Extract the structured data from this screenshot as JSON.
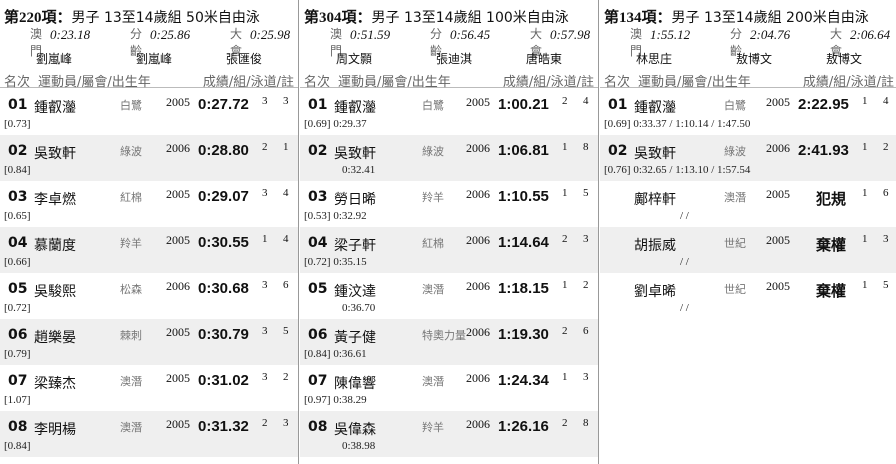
{
  "header": {
    "rank": "名次",
    "athlete": "運動員/屬會/出生年",
    "result": "成績/組/泳道/註"
  },
  "record_labels": {
    "macau": "澳門",
    "age": "分齡",
    "meet": "大會"
  },
  "events": [
    {
      "number": "第220項：",
      "description": "男子 13至14歲組 50米自由泳",
      "records": {
        "macau_time": "0:23.18",
        "macau_holder": "劉嵐峰",
        "age_time": "0:25.86",
        "age_holder": "劉嵐峰",
        "meet_time": "0:25.98",
        "meet_holder": "張匯俊"
      },
      "results": [
        {
          "rank": "01",
          "name": "鍾叡灐",
          "club": "白鷺",
          "year": "2005",
          "time": "0:27.72",
          "heat": "3",
          "lane": "3",
          "splits": "[0.73]"
        },
        {
          "rank": "02",
          "name": "吳致軒",
          "club": "綠波",
          "year": "2006",
          "time": "0:28.80",
          "heat": "2",
          "lane": "1",
          "splits": "[0.84]"
        },
        {
          "rank": "03",
          "name": "李卓燃",
          "club": "紅棉",
          "year": "2005",
          "time": "0:29.07",
          "heat": "3",
          "lane": "4",
          "splits": "[0.65]"
        },
        {
          "rank": "04",
          "name": "慕蘭度",
          "club": "羚羊",
          "year": "2005",
          "time": "0:30.55",
          "heat": "1",
          "lane": "4",
          "splits": "[0.66]"
        },
        {
          "rank": "05",
          "name": "吳駿熙",
          "club": "松森",
          "year": "2006",
          "time": "0:30.68",
          "heat": "3",
          "lane": "6",
          "splits": "[0.72]"
        },
        {
          "rank": "06",
          "name": "趙樂晏",
          "club": "棘刺",
          "year": "2005",
          "time": "0:30.79",
          "heat": "3",
          "lane": "5",
          "splits": "[0.79]"
        },
        {
          "rank": "07",
          "name": "梁臻杰",
          "club": "澳潛",
          "year": "2005",
          "time": "0:31.02",
          "heat": "3",
          "lane": "2",
          "splits": "[1.07]"
        },
        {
          "rank": "08",
          "name": "李明楊",
          "club": "澳潛",
          "year": "2005",
          "time": "0:31.32",
          "heat": "2",
          "lane": "3",
          "splits": "[0.84]"
        }
      ]
    },
    {
      "number": "第304項：",
      "description": "男子 13至14歲組 100米自由泳",
      "records": {
        "macau_time": "0:51.59",
        "macau_holder": "周文顥",
        "age_time": "0:56.45",
        "age_holder": "張迪淇",
        "meet_time": "0:57.98",
        "meet_holder": "唐皓東"
      },
      "results": [
        {
          "rank": "01",
          "name": "鍾叡灐",
          "club": "白鷺",
          "year": "2005",
          "time": "1:00.21",
          "heat": "2",
          "lane": "4",
          "splits": "[0.69]  0:29.37"
        },
        {
          "rank": "02",
          "name": "吳致軒",
          "club": "綠波",
          "year": "2006",
          "time": "1:06.81",
          "heat": "1",
          "lane": "8",
          "splits": "0:32.41"
        },
        {
          "rank": "03",
          "name": "勞日晞",
          "club": "羚羊",
          "year": "2006",
          "time": "1:10.55",
          "heat": "1",
          "lane": "5",
          "splits": "[0.53]  0:32.92"
        },
        {
          "rank": "04",
          "name": "梁子軒",
          "club": "紅棉",
          "year": "2006",
          "time": "1:14.64",
          "heat": "2",
          "lane": "3",
          "splits": "[0.72]  0:35.15"
        },
        {
          "rank": "05",
          "name": "鍾汶達",
          "club": "澳潛",
          "year": "2006",
          "time": "1:18.15",
          "heat": "1",
          "lane": "2",
          "splits": "0:36.70"
        },
        {
          "rank": "06",
          "name": "黃子健",
          "club": "特奧力量",
          "year": "2006",
          "time": "1:19.30",
          "heat": "2",
          "lane": "6",
          "splits": "[0.84]  0:36.61"
        },
        {
          "rank": "07",
          "name": "陳偉響",
          "club": "澳潛",
          "year": "2006",
          "time": "1:24.34",
          "heat": "1",
          "lane": "3",
          "splits": "[0.97]  0:38.29"
        },
        {
          "rank": "08",
          "name": "吳偉森",
          "club": "羚羊",
          "year": "2006",
          "time": "1:26.16",
          "heat": "2",
          "lane": "8",
          "splits": "0:38.98"
        }
      ]
    },
    {
      "number": "第134項：",
      "description": "男子 13至14歲組 200米自由泳",
      "records": {
        "macau_time": "1:55.12",
        "macau_holder": "林思庄",
        "age_time": "2:04.76",
        "age_holder": "敖博文",
        "meet_time": "2:06.64",
        "meet_holder": "敖博文"
      },
      "results": [
        {
          "rank": "01",
          "name": "鍾叡灐",
          "club": "白鷺",
          "year": "2005",
          "time": "2:22.95",
          "heat": "1",
          "lane": "4",
          "splits": "[0.69]  0:33.37  /  1:10.14  /  1:47.50"
        },
        {
          "rank": "02",
          "name": "吳致軒",
          "club": "綠波",
          "year": "2006",
          "time": "2:41.93",
          "heat": "1",
          "lane": "2",
          "splits": "[0.76]  0:32.65  /  1:13.10  /  1:57.54"
        },
        {
          "rank": "",
          "name": "鄺梓軒",
          "club": "澳潛",
          "year": "2005",
          "time": "犯規",
          "heat": "1",
          "lane": "6",
          "splits": "/          /"
        },
        {
          "rank": "",
          "name": "胡振威",
          "club": "世紀",
          "year": "2005",
          "time": "棄權",
          "heat": "1",
          "lane": "3",
          "splits": "/          /"
        },
        {
          "rank": "",
          "name": "劉卓晞",
          "club": "世紀",
          "year": "2005",
          "time": "棄權",
          "heat": "1",
          "lane": "5",
          "splits": "/          /"
        }
      ]
    }
  ]
}
